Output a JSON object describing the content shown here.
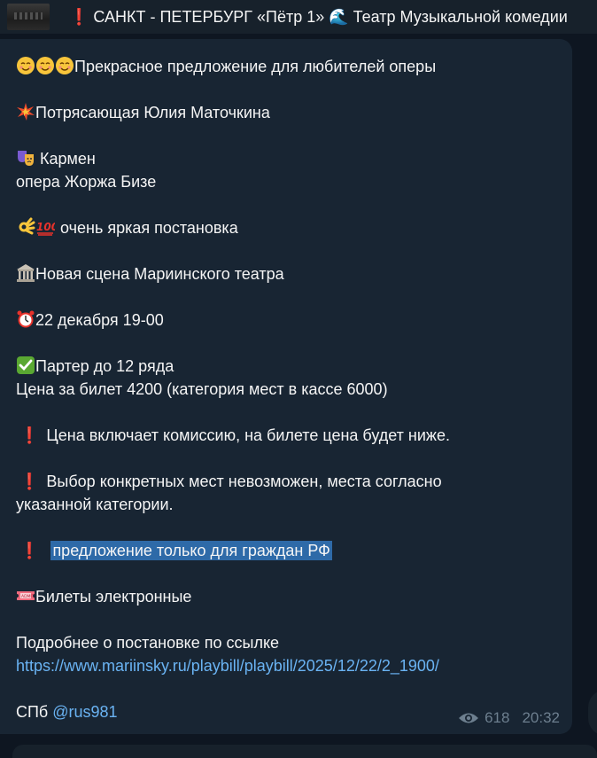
{
  "pinned": {
    "title": "❗️ САНКТ - ПЕТЕРБУРГ   «Пётр 1» 🌊 Театр Музыкальной комедии"
  },
  "message": {
    "lines": {
      "l1": "Прекрасное предложение для любителей оперы",
      "l2": "Потрясающая Юлия Маточкина",
      "l3": " Кармен",
      "l4": "опера Жоржа Бизе",
      "l5": "очень яркая постановка",
      "l6": "Новая сцена Мариинского театра",
      "l7": "22 декабря 19-00",
      "l8": "Партер до 12 ряда",
      "l9": "Цена за билет 4200 (категория мест в кассе 6000)",
      "l10": "Цена включает комиссию, на билете цена будет ниже.",
      "l11a": "Выбор конкретных мест невозможен, места согласно",
      "l11b": "указанной категории.",
      "l12": "предложение только для граждан РФ",
      "l13": "Билеты электронные",
      "l14": "Подробнее о постановке по ссылке",
      "link": "https://www.mariinsky.ru/playbill/playbill/2025/12/22/2_1900/",
      "signature_prefix": "СПб ",
      "signature_handle": "@rus981"
    },
    "views": "618",
    "time": "20:32"
  },
  "icons": {
    "smiley": "smiling-face-icon",
    "explosion": "collision-icon",
    "theater": "performing-arts-icon",
    "ok": "ok-hand-icon",
    "hundred": "hundred-points-icon",
    "classical": "classical-building-icon",
    "clock": "alarm-clock-icon",
    "check": "check-mark-button-icon",
    "ticket": "admission-ticket-icon",
    "exclaim": "red-exclamation-icon",
    "eye": "eye-icon"
  },
  "colors": {
    "background": "#0e1621",
    "bubble": "#182533",
    "link": "#6ab3f3",
    "selection": "#2e6aa8",
    "exclamation": "#e8322b"
  }
}
